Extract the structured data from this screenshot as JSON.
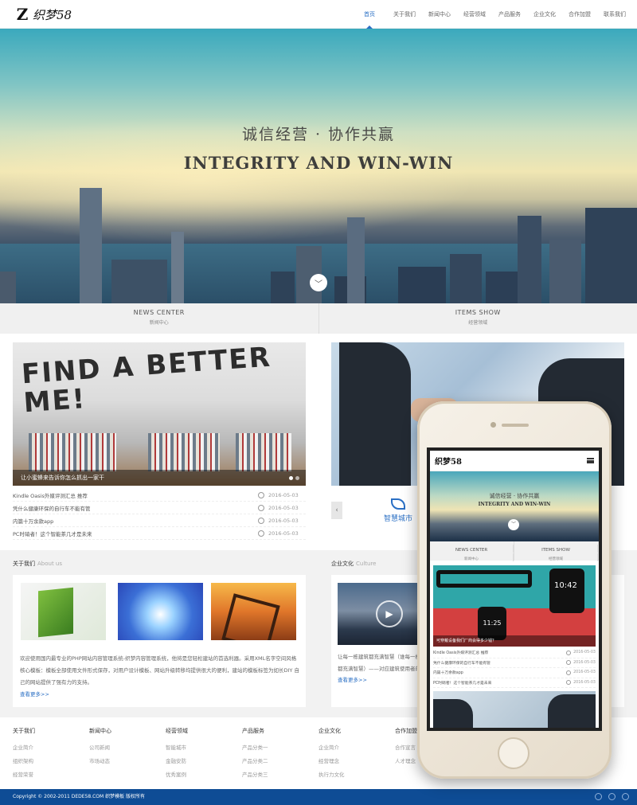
{
  "header": {
    "logo_text": "织梦58",
    "nav": [
      "首页",
      "关于我们",
      "新闻中心",
      "经营领域",
      "产品服务",
      "企业文化",
      "合作加盟",
      "联系我们"
    ]
  },
  "hero": {
    "title_cn": "诚信经营 · 协作共赢",
    "title_en": "INTEGRITY AND WIN-WIN"
  },
  "tabs": [
    {
      "en": "NEWS CENTER",
      "cn": "新闻中心"
    },
    {
      "en": "ITEMS SHOW",
      "cn": "经营领域"
    }
  ],
  "news": {
    "banner_text": "FIND A BETTER ME!",
    "caption": "让小蜜蜂来告诉你怎么抓出一家干",
    "items": [
      {
        "title": "Kindle Oasis外媒评测汇总 推荐",
        "date": "2016-05-03"
      },
      {
        "title": "凭什么健康环保的自行车不能有管",
        "date": "2016-05-03"
      },
      {
        "title": "内篇十万余款app",
        "date": "2016-05-03"
      },
      {
        "title": "PC时硝者！这个智能茶几才是未来",
        "date": "2016-05-03"
      }
    ]
  },
  "items_show": {
    "prev_arrow": "‹",
    "service_label": "智慧城市"
  },
  "about": {
    "title": "关于我们",
    "title_en": "About us",
    "text": "欢迎使用国内最专业的PHP网站内容管理系统-织梦内容管理系统，他将是您轻松建站的首选利器。采用XML名字空间风格核心模板：模板全部使用文件形式保存，对用户设计模板、网站升级转移均提供很大的便利，建站的模板标签为如长DIY 自己的网站提供了强有力的支持。",
    "more": "查看更多>>"
  },
  "culture": {
    "title": "企业文化",
    "title_en": "Culture",
    "text": "让每一栋建筑都充满智慧（谁每一栋建筑都充满智慧）——对应建筑使用者的核心需求",
    "more": "查看更多>>"
  },
  "footer_nav": [
    {
      "head": "关于我们",
      "links": [
        "企业简介",
        "组织架构",
        "经营荣誉"
      ]
    },
    {
      "head": "新闻中心",
      "links": [
        "公司新闻",
        "市场动态"
      ]
    },
    {
      "head": "经营领域",
      "links": [
        "智能城市",
        "金融安防",
        "优秀案例"
      ]
    },
    {
      "head": "产品服务",
      "links": [
        "产品分类一",
        "产品分类二",
        "产品分类三"
      ]
    },
    {
      "head": "企业文化",
      "links": [
        "企业简介",
        "经营理念",
        "执行力文化"
      ]
    },
    {
      "head": "合作加盟",
      "links": [
        "合作宣言",
        "人才理念"
      ]
    }
  ],
  "footer": {
    "copyright": "Copyright © 2002-2011 DEDE58.COM 织梦模板 版权所有"
  },
  "mobile": {
    "logo_text": "织梦58",
    "hero_cn": "诚信经营 · 协作共赢",
    "hero_en": "INTEGRITY AND WIN-WIN",
    "tabs": [
      {
        "en": "NEWS CENTER",
        "cn": "新闻中心"
      },
      {
        "en": "ITEMS SHOW",
        "cn": "经营领域"
      }
    ],
    "watch_time_1": "10:42",
    "watch_time_2": "11:25",
    "caption": "可穿戴设备我们厂商会得多少钱？",
    "items": [
      {
        "title": "Kindle Oasis外媒评测汇总 推荐",
        "date": "2016-05-03"
      },
      {
        "title": "凭什么健康环保的自行车不能有管",
        "date": "2016-05-03"
      },
      {
        "title": "内篇十万余款app",
        "date": "2016-05-03"
      },
      {
        "title": "PC时硝者！这个智能茶几才是未来",
        "date": "2016-05-03"
      }
    ]
  },
  "colors": {
    "accent": "#2a6fc4",
    "footer_bg": "#0e4c95"
  }
}
